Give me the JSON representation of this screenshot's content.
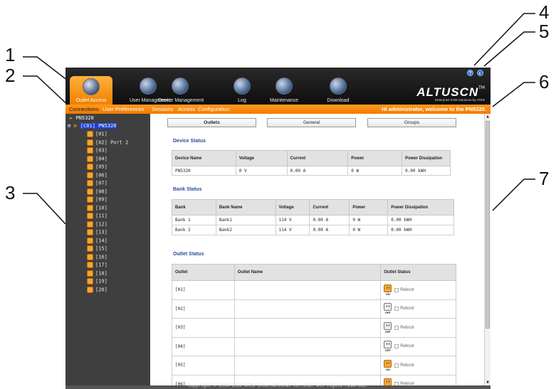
{
  "callouts": [
    "1",
    "2",
    "3",
    "4",
    "5",
    "6",
    "7"
  ],
  "topbar": {
    "tabs": [
      {
        "label": "Outlet Access",
        "icon": "outlet-access-icon",
        "active": true
      },
      {
        "label": "User Management",
        "icon": "user-management-icon",
        "active": false
      },
      {
        "label": "Device Management",
        "icon": "device-management-icon",
        "active": false
      },
      {
        "label": "Log",
        "icon": "log-icon",
        "active": false
      },
      {
        "label": "Maintenance",
        "icon": "maintenance-icon",
        "active": false
      },
      {
        "label": "Download",
        "icon": "download-icon",
        "active": false
      }
    ],
    "help_icon": "?",
    "logout_icon": "◐",
    "logo": "ALTUSCN",
    "logo_tm": "TM",
    "logo_sub": "Enterprise KVM Solutions by ATEN"
  },
  "subbar": {
    "links": [
      "Connections",
      "User Preferences",
      "Sessions",
      "Access",
      "Configuration"
    ],
    "welcome": "Hi administrator, welcome to the PN5320."
  },
  "sidebar": {
    "root": "PN5320",
    "device_prefix": "⊟",
    "device": "[C01] PN5320",
    "outlets": [
      "[01]",
      "[02] Port 2",
      "[03]",
      "[04]",
      "[05]",
      "[06]",
      "[07]",
      "[08]",
      "[09]",
      "[10]",
      "[11]",
      "[12]",
      "[13]",
      "[14]",
      "[15]",
      "[16]",
      "[17]",
      "[18]",
      "[19]",
      "[20]"
    ]
  },
  "main": {
    "subtabs": [
      "Outlets",
      "General",
      "Groups"
    ],
    "device_status": {
      "title": "Device Status",
      "headers": [
        "Device Name",
        "Voltage",
        "Current",
        "Power",
        "Power Dissipation"
      ],
      "rows": [
        [
          "PN5320",
          "0 V",
          "0.00 A",
          "0 W",
          "0.00 kWH"
        ]
      ]
    },
    "bank_status": {
      "title": "Bank Status",
      "headers": [
        "Bank",
        "Bank Name",
        "Voltage",
        "Current",
        "Power",
        "Power Dissipation"
      ],
      "rows": [
        [
          "Bank 1",
          "Bank1",
          "114 V",
          "0.00 A",
          "0 W",
          "0.00 kWH"
        ],
        [
          "Bank 2",
          "Bank2",
          "114 V",
          "0.00 A",
          "0 W",
          "0.00 kWH"
        ]
      ]
    },
    "outlet_status": {
      "title": "Outlet Status",
      "headers": [
        "Outlet",
        "Outlet Name",
        "Outlet Status"
      ],
      "reboot_label": "Reboot",
      "rows": [
        {
          "outlet": "[01]",
          "name": "",
          "state": "ON"
        },
        {
          "outlet": "[02]",
          "name": "",
          "state": "OFF"
        },
        {
          "outlet": "[03]",
          "name": "",
          "state": "OFF"
        },
        {
          "outlet": "[04]",
          "name": "",
          "state": "OFF"
        },
        {
          "outlet": "[05]",
          "name": "",
          "state": "ON"
        },
        {
          "outlet": "[06]",
          "name": "",
          "state": "ON"
        }
      ]
    }
  },
  "footer": "Copyright © 2004-2010 ATEN International Co.,Ltd. All rights reserved."
}
